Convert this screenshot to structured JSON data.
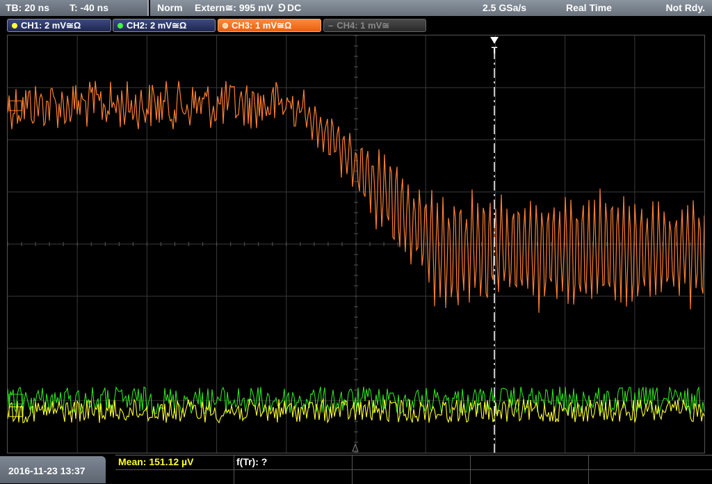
{
  "topbar": {
    "timebase": "TB: 20 ns",
    "trigger_time": "T: -40 ns",
    "mode": "Norm",
    "trigger_source": "Extern≅: 995 mV",
    "trigger_slope": "⅁",
    "trigger_coupling": "DC",
    "sample_rate": "2.5 GSa/s",
    "acquisition": "Real Time",
    "state": "Not Rdy."
  },
  "channels": [
    {
      "label": "CH1: 2 mV≅Ω",
      "color": "#ffff40",
      "state": "on"
    },
    {
      "label": "CH2: 2 mV≅Ω",
      "color": "#40ff40",
      "state": "on"
    },
    {
      "label": "CH3: 1 mV≅Ω",
      "color": "#ff7a20",
      "state": "active"
    },
    {
      "label": "CH4: 1 mV≅",
      "color": "#888888",
      "state": "off"
    }
  ],
  "trigger_marker": "T",
  "bottom": {
    "datetime": "2016-11-23 13:37",
    "mean_label": "Mean: 151.12 µV",
    "ftr_label": "f(Tr): ?"
  },
  "colors": {
    "ch1": "#ffff30",
    "ch2": "#30e020",
    "ch3": "#ff8030",
    "grid": "#444444",
    "trigger_line": "#ffffff"
  }
}
